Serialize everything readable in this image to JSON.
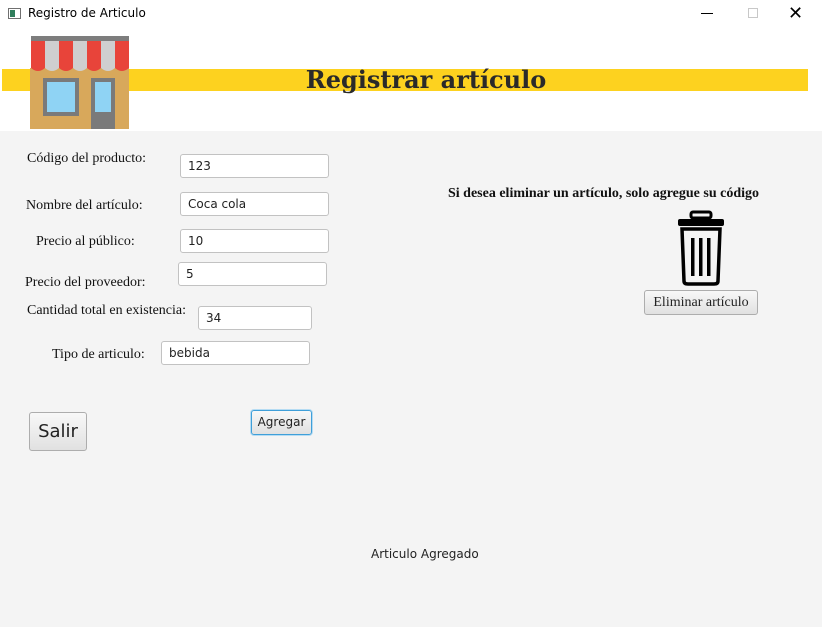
{
  "window": {
    "title": "Registro de Articulo",
    "controls": {
      "minimize": "minimize-icon",
      "maximize": "maximize-icon",
      "close": "✕"
    }
  },
  "header": {
    "title": "Registrar artículo",
    "logo_icon": "store-icon",
    "band_color": "#fdd21f"
  },
  "form": {
    "fields": [
      {
        "label": "Código del producto:",
        "value": "123"
      },
      {
        "label": "Nombre del artículo:",
        "value": "Coca cola"
      },
      {
        "label": "Precio al público:",
        "value": "10"
      },
      {
        "label": "Precio del proveedor:",
        "value": "5"
      },
      {
        "label": "Cantidad total en existencia:",
        "value": "34"
      },
      {
        "label": "Tipo de articulo:",
        "value": "bebida"
      }
    ],
    "exit_button": "Salir",
    "add_button": "Agregar"
  },
  "delete_panel": {
    "hint": "Si desea eliminar un artículo, solo agregue su código",
    "icon": "trash-icon",
    "button": "Eliminar artículo"
  },
  "status": {
    "message": "Articulo Agregado"
  }
}
